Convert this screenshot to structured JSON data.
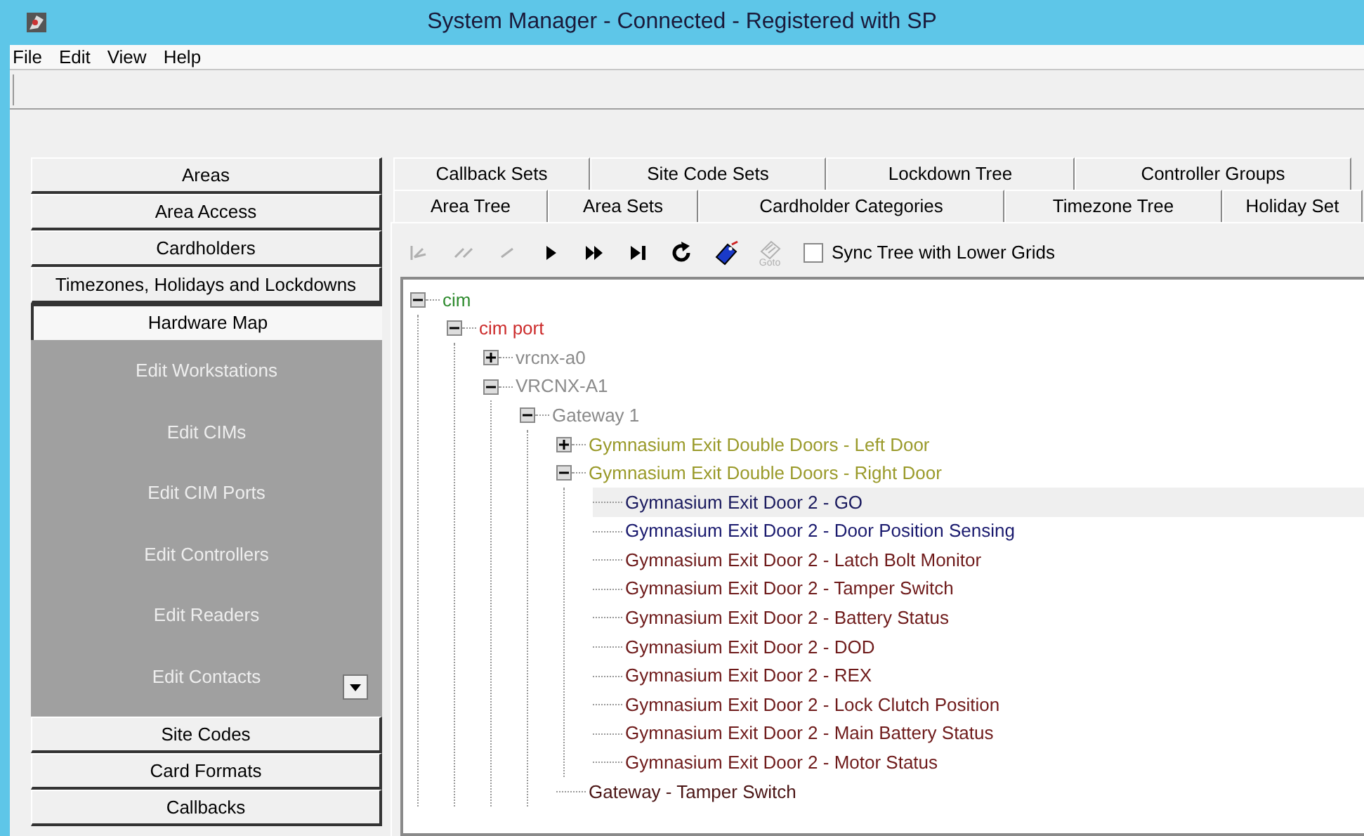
{
  "window": {
    "title": "System Manager - Connected - Registered with SP"
  },
  "menu": [
    "File",
    "Edit",
    "View",
    "Help"
  ],
  "sidebar": {
    "top": [
      {
        "label": "Areas",
        "selected": false
      },
      {
        "label": "Area Access",
        "selected": false
      },
      {
        "label": "Cardholders",
        "selected": false
      },
      {
        "label": "Timezones, Holidays and Lockdowns",
        "selected": false
      },
      {
        "label": "Hardware Map",
        "selected": true
      }
    ],
    "subitems": [
      "Edit Workstations",
      "Edit CIMs",
      "Edit CIM Ports",
      "Edit Controllers",
      "Edit Readers",
      "Edit Contacts"
    ],
    "bottom": [
      {
        "label": "Site Codes",
        "selected": false
      },
      {
        "label": "Card Formats",
        "selected": false
      },
      {
        "label": "Callbacks",
        "selected": false
      }
    ]
  },
  "tabs_back": [
    "Callback Sets",
    "Site Code Sets",
    "Lockdown Tree",
    "Controller Groups"
  ],
  "tabs_front": [
    "Area Tree",
    "Area Sets",
    "Cardholder Categories",
    "Timezone Tree",
    "Holiday Set"
  ],
  "toolbar": {
    "tools": [
      {
        "kind": "first",
        "disabled": true
      },
      {
        "kind": "prev2",
        "disabled": true
      },
      {
        "kind": "prev",
        "disabled": true
      },
      {
        "kind": "play",
        "disabled": false
      },
      {
        "kind": "ffwd",
        "disabled": false
      },
      {
        "kind": "last",
        "disabled": false
      },
      {
        "kind": "refresh",
        "disabled": false
      },
      {
        "kind": "tag",
        "disabled": false
      },
      {
        "kind": "goto",
        "disabled": true,
        "label": "Goto"
      }
    ],
    "sync": {
      "label": "Sync Tree with Lower Grids",
      "checked": false
    }
  },
  "tree": [
    {
      "label": "cim",
      "color": "#2e8b2e",
      "expanded": true,
      "selected": false,
      "children": [
        {
          "label": "cim port",
          "color": "#cc2b2b",
          "expanded": true,
          "selected": false,
          "children": [
            {
              "label": "vrcnx-a0",
              "color": "#8a8a8a",
              "expanded": false,
              "selected": false
            },
            {
              "label": "VRCNX-A1",
              "color": "#8a8a8a",
              "expanded": true,
              "selected": false,
              "children": [
                {
                  "label": "Gateway 1",
                  "color": "#8a8a8a",
                  "expanded": true,
                  "selected": false,
                  "children": [
                    {
                      "label": "Gymnasium Exit Double Doors - Left Door",
                      "color": "#9a9a2a",
                      "expanded": false,
                      "selected": false
                    },
                    {
                      "label": "Gymnasium Exit Double Doors - Right Door",
                      "color": "#9a9a2a",
                      "expanded": true,
                      "selected": false,
                      "children": [
                        {
                          "label": "Gymnasium Exit Door 2 - GO",
                          "color": "#1a1a5e",
                          "selected": true
                        },
                        {
                          "label": "Gymnasium Exit Door 2 - Door Position Sensing",
                          "color": "#1a1a6e",
                          "selected": false
                        },
                        {
                          "label": "Gymnasium Exit Door 2 - Latch Bolt Monitor",
                          "color": "#6e1a1a",
                          "selected": false
                        },
                        {
                          "label": "Gymnasium Exit Door 2 - Tamper Switch",
                          "color": "#6e1a1a",
                          "selected": false
                        },
                        {
                          "label": "Gymnasium Exit Door 2 - Battery Status",
                          "color": "#6e1a1a",
                          "selected": false
                        },
                        {
                          "label": "Gymnasium Exit Door 2 - DOD",
                          "color": "#6e1a1a",
                          "selected": false
                        },
                        {
                          "label": "Gymnasium Exit Door 2 - REX",
                          "color": "#6e1a1a",
                          "selected": false
                        },
                        {
                          "label": "Gymnasium Exit Door 2 - Lock Clutch Position",
                          "color": "#6e1a1a",
                          "selected": false
                        },
                        {
                          "label": "Gymnasium Exit Door 2 - Main Battery Status",
                          "color": "#6e1a1a",
                          "selected": false
                        },
                        {
                          "label": "Gymnasium Exit Door 2 - Motor Status",
                          "color": "#6e1a1a",
                          "selected": false
                        }
                      ]
                    },
                    {
                      "label": "Gateway - Tamper Switch",
                      "color": "#4a1414",
                      "selected": false
                    }
                  ]
                }
              ]
            }
          ]
        }
      ]
    }
  ]
}
